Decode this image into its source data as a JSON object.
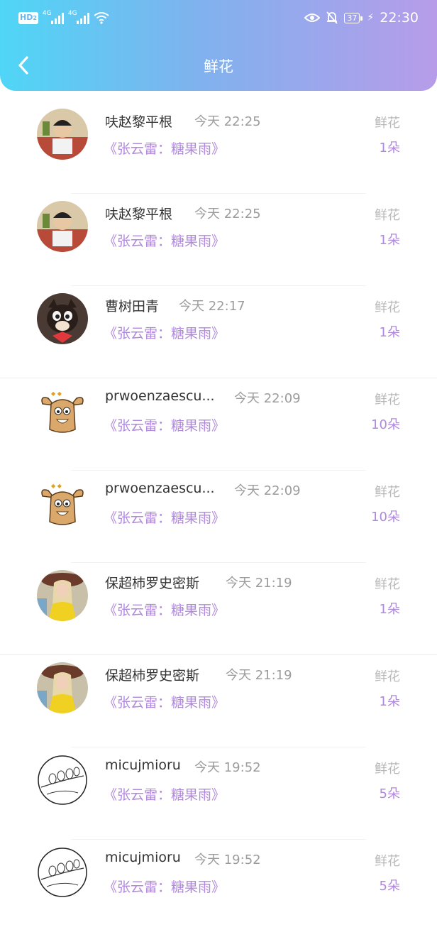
{
  "status_bar": {
    "hd": "HD",
    "hd_sub": "2",
    "net1": "4G",
    "net2": "4G",
    "battery": "37",
    "time": "22:30"
  },
  "header": {
    "title": "鲜花"
  },
  "items": [
    {
      "name": "呋赵黎平根",
      "time": "今天 22:25",
      "song": "《张云雷：糖果雨》",
      "gift": "鲜花",
      "count": "1朵",
      "avatar": "man-avatar"
    },
    {
      "name": "呋赵黎平根",
      "time": "今天 22:25",
      "song": "《张云雷：糖果雨》",
      "gift": "鲜花",
      "count": "1朵",
      "avatar": "man-avatar"
    },
    {
      "name": "曹树田青",
      "time": "今天 22:17",
      "song": "《张云雷：糖果雨》",
      "gift": "鲜花",
      "count": "1朵",
      "avatar": "cat-avatar"
    },
    {
      "name": "prwoenzaescu...",
      "time": "今天 22:09",
      "song": "《张云雷：糖果雨》",
      "gift": "鲜花",
      "count": "10朵",
      "avatar": "cartoon-avatar"
    },
    {
      "name": "prwoenzaescu...",
      "time": "今天 22:09",
      "song": "《张云雷：糖果雨》",
      "gift": "鲜花",
      "count": "10朵",
      "avatar": "cartoon-avatar"
    },
    {
      "name": "保超杮罗史密斯",
      "time": "今天 21:19",
      "song": "《张云雷：糖果雨》",
      "gift": "鲜花",
      "count": "1朵",
      "avatar": "girl-avatar"
    },
    {
      "name": "保超杮罗史密斯",
      "time": "今天 21:19",
      "song": "《张云雷：糖果雨》",
      "gift": "鲜花",
      "count": "1朵",
      "avatar": "girl-avatar"
    },
    {
      "name": "micujmioru",
      "time": "今天 19:52",
      "song": "《张云雷：糖果雨》",
      "gift": "鲜花",
      "count": "5朵",
      "avatar": "sketch-avatar"
    },
    {
      "name": "micujmioru",
      "time": "今天 19:52",
      "song": "《张云雷：糖果雨》",
      "gift": "鲜花",
      "count": "5朵",
      "avatar": "sketch-avatar"
    }
  ]
}
